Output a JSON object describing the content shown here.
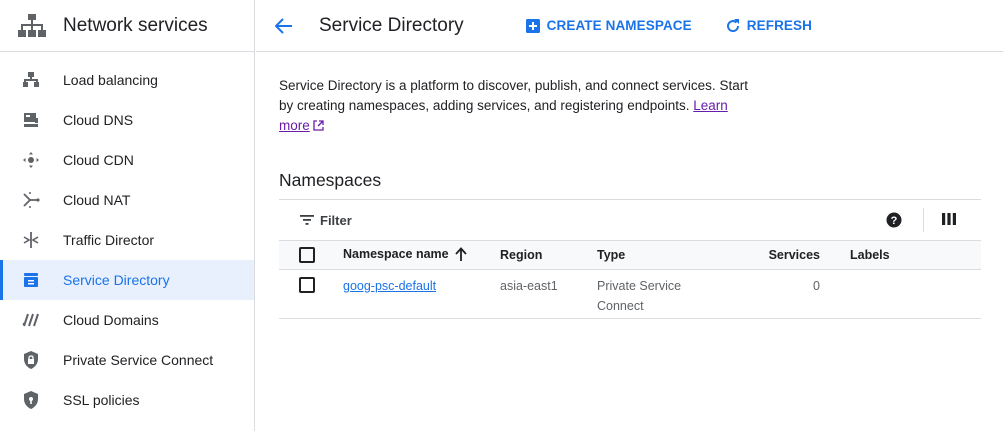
{
  "sidebar": {
    "title": "Network services",
    "items": [
      {
        "label": "Load balancing",
        "icon": "load-balancing-icon"
      },
      {
        "label": "Cloud DNS",
        "icon": "dns-icon"
      },
      {
        "label": "Cloud CDN",
        "icon": "cdn-icon"
      },
      {
        "label": "Cloud NAT",
        "icon": "nat-icon"
      },
      {
        "label": "Traffic Director",
        "icon": "traffic-director-icon"
      },
      {
        "label": "Service Directory",
        "icon": "service-directory-icon",
        "active": true
      },
      {
        "label": "Cloud Domains",
        "icon": "domains-icon"
      },
      {
        "label": "Private Service Connect",
        "icon": "lock-shield-icon"
      },
      {
        "label": "SSL policies",
        "icon": "shield-icon"
      }
    ]
  },
  "header": {
    "title": "Service Directory",
    "create_label": "CREATE NAMESPACE",
    "refresh_label": "REFRESH"
  },
  "main": {
    "description": "Service Directory is a platform to discover, publish, and connect services. Start by creating namespaces, adding services, and registering endpoints.",
    "learn_more": "Learn more",
    "section_title": "Namespaces",
    "filter_label": "Filter",
    "table": {
      "columns": {
        "name": "Namespace name",
        "region": "Region",
        "type": "Type",
        "services": "Services",
        "labels": "Labels"
      },
      "rows": [
        {
          "name": "goog-psc-default",
          "region": "asia-east1",
          "type": "Private Service Connect",
          "services": "0",
          "labels": ""
        }
      ]
    }
  },
  "colors": {
    "accent": "#1a73e8",
    "active_bg": "#e8f0fe",
    "link_visited": "#681da8"
  }
}
